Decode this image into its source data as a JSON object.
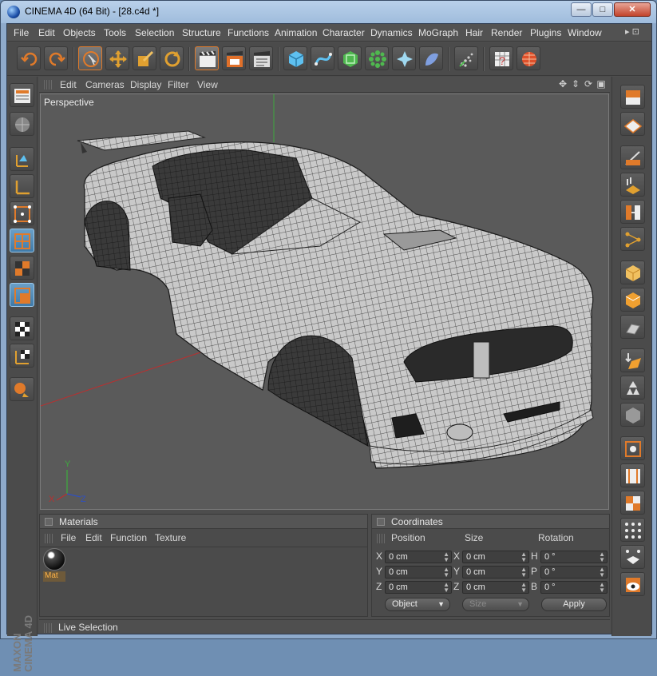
{
  "window": {
    "title": "CINEMA 4D (64 Bit) - [28.c4d *]",
    "min": "—",
    "max": "□",
    "close": "✕"
  },
  "menubar": {
    "items": [
      "File",
      "Edit",
      "Objects",
      "Tools",
      "Selection",
      "Structure",
      "Functions",
      "Animation",
      "Character",
      "Dynamics",
      "MoGraph",
      "Hair",
      "Render",
      "Plugins",
      "Window"
    ],
    "arrows": "▸ ⊡"
  },
  "viewport": {
    "menu": [
      "Edit",
      "Cameras",
      "Display",
      "Filter",
      "View"
    ],
    "label": "Perspective",
    "nav_icons": [
      "✥",
      "⇕",
      "⟳",
      "▣"
    ],
    "axis_labels": {
      "y": "Y",
      "x": "X",
      "z": "Z"
    }
  },
  "materials": {
    "title": "Materials",
    "menu": [
      "File",
      "Edit",
      "Function",
      "Texture"
    ],
    "item_label": "Mat"
  },
  "coordinates": {
    "title": "Coordinates",
    "headers": {
      "position": "Position",
      "size": "Size",
      "rotation": "Rotation"
    },
    "rows": [
      {
        "pos_axis": "X",
        "pos": "0 cm",
        "size_axis": "X",
        "size": "0 cm",
        "rot_axis": "H",
        "rot": "0 °"
      },
      {
        "pos_axis": "Y",
        "pos": "0 cm",
        "size_axis": "Y",
        "size": "0 cm",
        "rot_axis": "P",
        "rot": "0 °"
      },
      {
        "pos_axis": "Z",
        "pos": "0 cm",
        "size_axis": "Z",
        "size": "0 cm",
        "rot_axis": "B",
        "rot": "0 °"
      }
    ],
    "mode": "Object",
    "size_mode": "Size",
    "apply": "Apply"
  },
  "status": {
    "text": "Live Selection"
  },
  "brand": {
    "line1": "MAXON",
    "line2": "CINEMA 4D"
  },
  "colors": {
    "accent": "#e07a2a",
    "active_tool": "#3f7aa8",
    "viewport_bg": "#5a5a5a"
  }
}
